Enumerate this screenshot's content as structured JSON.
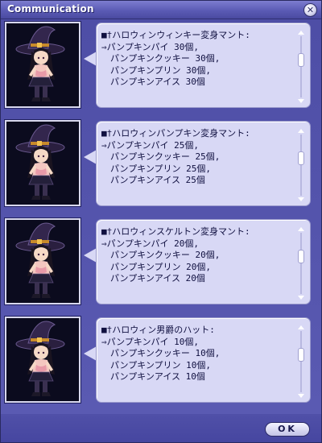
{
  "window": {
    "title": "Communication",
    "close_icon": "close-icon"
  },
  "entries": [
    {
      "portrait_icon": "witch-portrait",
      "lines": [
        "■†ハロウィンウィンキー変身マント:",
        "⇒パンプキンパイ 30個,",
        "　パンプキンクッキー 30個,",
        "　パンプキンプリン 30個,",
        "　パンプキンアイス 30個"
      ]
    },
    {
      "portrait_icon": "witch-portrait",
      "lines": [
        "■†ハロウィンパンプキン変身マント:",
        "⇒パンプキンパイ 25個,",
        "　パンプキンクッキー 25個,",
        "　パンプキンプリン 25個,",
        "　パンプキンアイス 25個"
      ]
    },
    {
      "portrait_icon": "witch-portrait",
      "lines": [
        "■†ハロウィンスケルトン変身マント:",
        "⇒パンプキンパイ 20個,",
        "　パンプキンクッキー 20個,",
        "　パンプキンプリン 20個,",
        "　パンプキンアイス 20個"
      ]
    },
    {
      "portrait_icon": "witch-portrait",
      "lines": [
        "■†ハロウィン男爵のハット:",
        "⇒パンプキンパイ 10個,",
        "　パンプキンクッキー 10個,",
        "　パンプキンプリン 10個,",
        "　パンプキンアイス 10個"
      ]
    }
  ],
  "footer": {
    "ok_label": "OK"
  },
  "colors": {
    "window_bg": "#5b5bb0",
    "bubble_bg": "#d8d8f5",
    "text": "#101040"
  }
}
